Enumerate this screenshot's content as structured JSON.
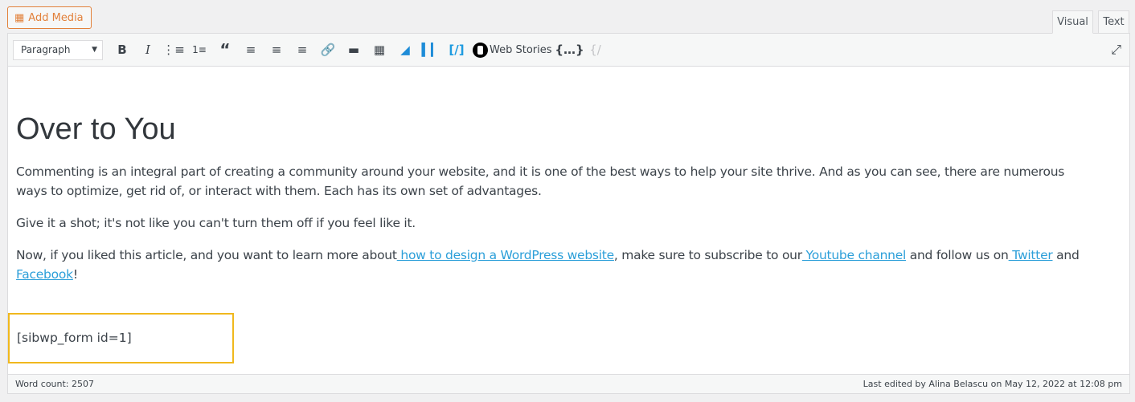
{
  "add_media": {
    "label": "Add Media",
    "icon": "media-icon",
    "color": "#e2813b"
  },
  "tabs": [
    {
      "label": "Visual",
      "active": true
    },
    {
      "label": "Text",
      "active": false
    }
  ],
  "toolbar": {
    "format_select": "Paragraph",
    "web_stories": "Web Stories"
  },
  "content": {
    "heading": "Over to You",
    "p1": "Commenting is an integral part of creating a community around your website, and it is one of the best ways to help your site thrive. And as you can see, there are numerous ways to optimize, get rid of, or interact with them. Each has its own set of advantages.",
    "p2": "Give it a shot; it's not like you can't turn them off if you feel like it.",
    "p3": {
      "t1": "Now, if you liked this article, and you want to learn more about",
      "l1": " how to design a WordPress website",
      "t2": ", make sure to subscribe to our",
      "l2": " Youtube channel",
      "t3": " and follow us on",
      "l3": " Twitter",
      "t4": " and ",
      "l4": "Facebook",
      "t5": "!"
    },
    "shortcode": "[sibwp_form id=1]"
  },
  "status": {
    "word_count": "Word count: 2507",
    "last_edited": "Last edited by Alina Belascu on May 12, 2022 at 12:08 pm"
  },
  "link_color": "#2c9fd9"
}
